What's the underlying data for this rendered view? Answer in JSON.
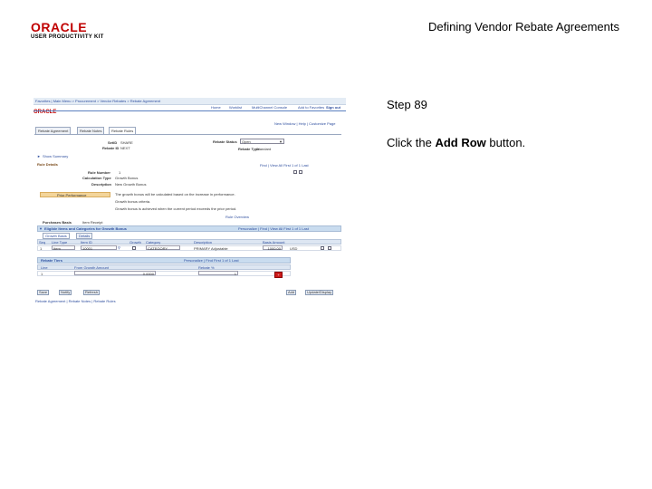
{
  "brand": {
    "line1": "ORACLE",
    "line2": "USER PRODUCTIVITY KIT"
  },
  "doc_title": "Defining Vendor Rebate Agreements",
  "step_label": "Step 89",
  "instruction": {
    "before": "Click the ",
    "bold": "Add Row",
    "after": " button."
  },
  "screenshot": {
    "breadcrumb": "Favorites  |  Main Menu  >  Procurement  >  Vendor Rebates  >  Rebate Agreement",
    "top_links": [
      "Home",
      "Worklist",
      "MultiChannel Console",
      "Add to Favorites",
      "Sign out"
    ],
    "logo": "ORACLE",
    "page_links": "New Window  |  Help  |  Customize Page",
    "tabs": [
      "Rebate Agreement",
      "Rebate Notes",
      "Rebate Rules"
    ],
    "setid_label": "SetID",
    "setid_value": "SHARE",
    "rebate_id_label": "Rebate ID",
    "rebate_id_value": "NEXT",
    "status_label": "Rebate Status",
    "status_value": "Open",
    "type_label": "Rebate Type",
    "type_value": "Standard",
    "summary_link": "Show Summary",
    "rule_details": "Rule Details",
    "pager_top": "Find  |  View All   First  1 of 1  Last",
    "rule_number_label": "Rule Number",
    "rule_number_value": "1",
    "calc_type_label": "Calculation Type",
    "calc_type_value": "Growth Bonus",
    "desc_label": "Description",
    "desc_value": "New Growth Bonus",
    "prev_btn": "Prior Performance",
    "desc_lines": [
      "The growth bonus will be calculated based on the increase in performance.",
      "Growth bonus criteria.",
      "Growth bonus is achieved when the current period exceeds the prior period."
    ],
    "rule_overview": "Rule Overview",
    "apply_label": "Purchases Basis",
    "apply_value": "Item Receipt",
    "section_title": "Eligible Items and Categories for Growth Bonus",
    "pager_mid": "Personalize  |  Find  |  View All     First  1 of 1  Last",
    "inner_tabs": [
      "Growth Basis",
      "Details"
    ],
    "cols": [
      "Seq",
      "Line Type",
      "Item ID",
      "Growth",
      "Category",
      "Description",
      "Basis Amount"
    ],
    "row": [
      "1",
      "Item",
      "10001",
      "",
      "CATEGORY",
      "PRIMARY Adjustable",
      "1000.00",
      "USD"
    ],
    "tiers_title": "Rebate Tiers",
    "pager_tiers": "Personalize  |  Find     First  1 of 1  Last",
    "tier_cols": [
      "Line",
      "From Growth Amount",
      "Rebate %"
    ],
    "tier_row": [
      "1",
      "0.0000",
      "1"
    ],
    "add_row_symbol": "+",
    "bottom_left": [
      "Save",
      "Notify",
      "Refresh"
    ],
    "bottom_right": [
      "Add",
      "Update/Display"
    ],
    "footer_links": "Rebate Agreement | Rebate Notes | Rebate Rules"
  }
}
